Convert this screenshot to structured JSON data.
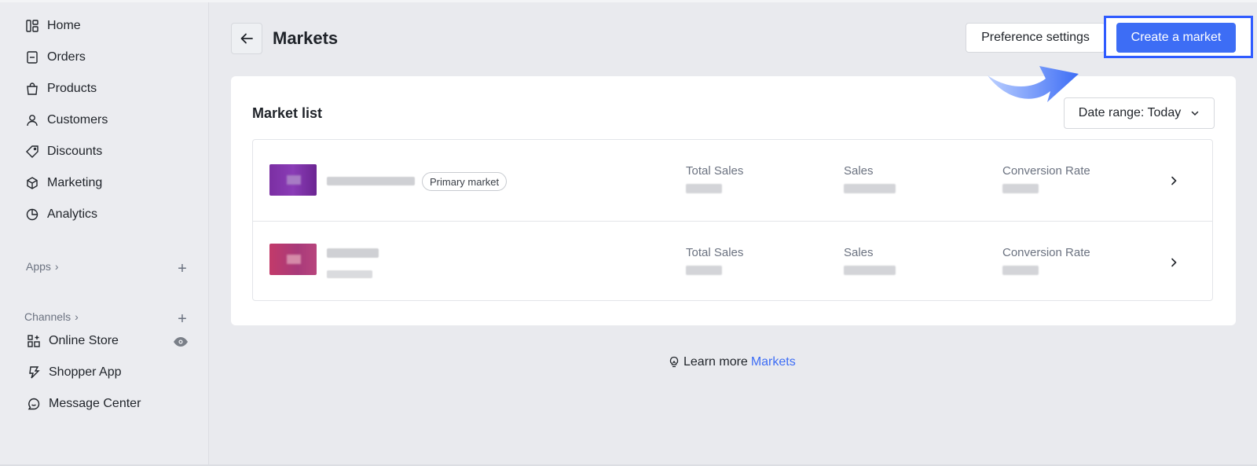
{
  "sidebar": {
    "items": [
      {
        "label": "Home",
        "icon": "home-icon"
      },
      {
        "label": "Orders",
        "icon": "orders-icon"
      },
      {
        "label": "Products",
        "icon": "products-icon"
      },
      {
        "label": "Customers",
        "icon": "customers-icon"
      },
      {
        "label": "Discounts",
        "icon": "discounts-icon"
      },
      {
        "label": "Marketing",
        "icon": "marketing-icon"
      },
      {
        "label": "Analytics",
        "icon": "analytics-icon"
      }
    ],
    "apps_label": "Apps",
    "channels_label": "Channels",
    "channels": [
      {
        "label": "Online Store",
        "icon": "online-store-icon"
      },
      {
        "label": "Shopper App",
        "icon": "shopper-app-icon"
      },
      {
        "label": "Message Center",
        "icon": "message-center-icon"
      }
    ]
  },
  "header": {
    "title": "Markets",
    "preference_label": "Preference settings",
    "create_label": "Create a market"
  },
  "market_list": {
    "title": "Market list",
    "date_range_label": "Date range: Today",
    "primary_badge": "Primary market",
    "columns": [
      "Total Sales",
      "Sales",
      "Conversion Rate"
    ]
  },
  "footer": {
    "learn_text": "Learn more",
    "link_text": "Markets"
  },
  "colors": {
    "accent": "#3d6df5",
    "highlight": "#2f5bff"
  }
}
